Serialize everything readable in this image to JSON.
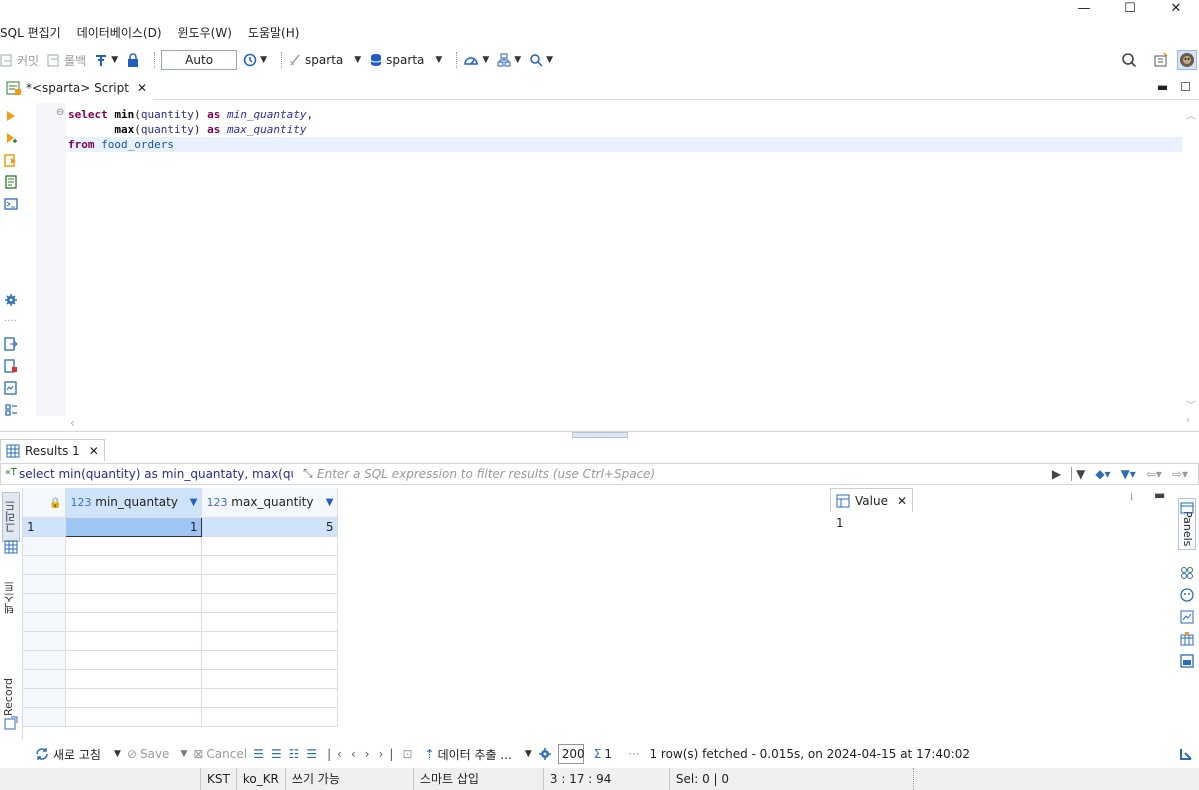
{
  "menubar": {
    "items": [
      "SQL 편집기",
      "데이터베이스(D)",
      "윈도우(W)",
      "도움말(H)"
    ]
  },
  "toolbar": {
    "commit_label": "커밋",
    "rollback_label": "롤백",
    "transaction_mode": "Auto",
    "datasource_label": "sparta",
    "schema_label": "sparta"
  },
  "editor": {
    "tab_label": "*<sparta> Script",
    "lines": [
      "select min(quantity) as min_quantaty,",
      "       max(quantity) as max_quantity",
      "from food_orders"
    ]
  },
  "results": {
    "tab_label": "Results 1",
    "sql_preview": "select min(quantity) as min_quantaty, max(quantit",
    "filter_placeholder": "Enter a SQL expression to filter results (use Ctrl+Space)",
    "columns": [
      {
        "type": "123",
        "name": "min_quantaty"
      },
      {
        "type": "123",
        "name": "max_quantity"
      }
    ],
    "rows": [
      {
        "num": "1",
        "values": [
          "1",
          "5"
        ]
      }
    ],
    "side_tabs": [
      "그리드",
      "텍스트",
      "Record"
    ],
    "value_panel": {
      "tab_label": "Value",
      "content": "1"
    },
    "panels_label": "Panels"
  },
  "results_toolbar": {
    "refresh_label": "새로 고침",
    "save_label": "Save",
    "cancel_label": "Cancel",
    "export_label": "데이터 추출 ...",
    "fetch_size": "200",
    "row_count": "1",
    "status": "1 row(s) fetched - 0.015s, on 2024-04-15 at 17:40:02"
  },
  "statusbar": {
    "timezone": "KST",
    "locale": "ko_KR",
    "mode": "쓰기 가능",
    "insert_mode": "스마트 삽입",
    "position": "3 : 17 : 94",
    "selection": "Sel: 0 | 0"
  },
  "colors": {
    "accent_blue": "#1f5fbf",
    "selection": "#cfe3fb",
    "keyword": "#7f0055",
    "orange_icon": "#f39c12"
  }
}
